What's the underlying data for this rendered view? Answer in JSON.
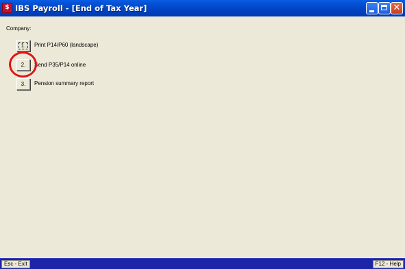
{
  "window": {
    "title": "IBS Payroll - [End of Tax Year]"
  },
  "company_label": "Company:",
  "menu": {
    "items": [
      {
        "key": "1.",
        "label": "Print P14/P60 (landscape)"
      },
      {
        "key": "2.",
        "label": "Send P35/P14 online"
      },
      {
        "key": "3.",
        "label": "Pension summary report"
      }
    ]
  },
  "statusbar": {
    "esc": "Esc - Exit",
    "help": "F12 - Help"
  },
  "colors": {
    "titlebar": "#0043c4",
    "statusbar": "#1d24a8",
    "annotation": "#e01414",
    "background": "#ece9d8"
  },
  "icons": {
    "app": "ibs-app-icon",
    "minimize": "minimize-icon",
    "maximize": "maximize-icon",
    "close": "close-icon"
  }
}
